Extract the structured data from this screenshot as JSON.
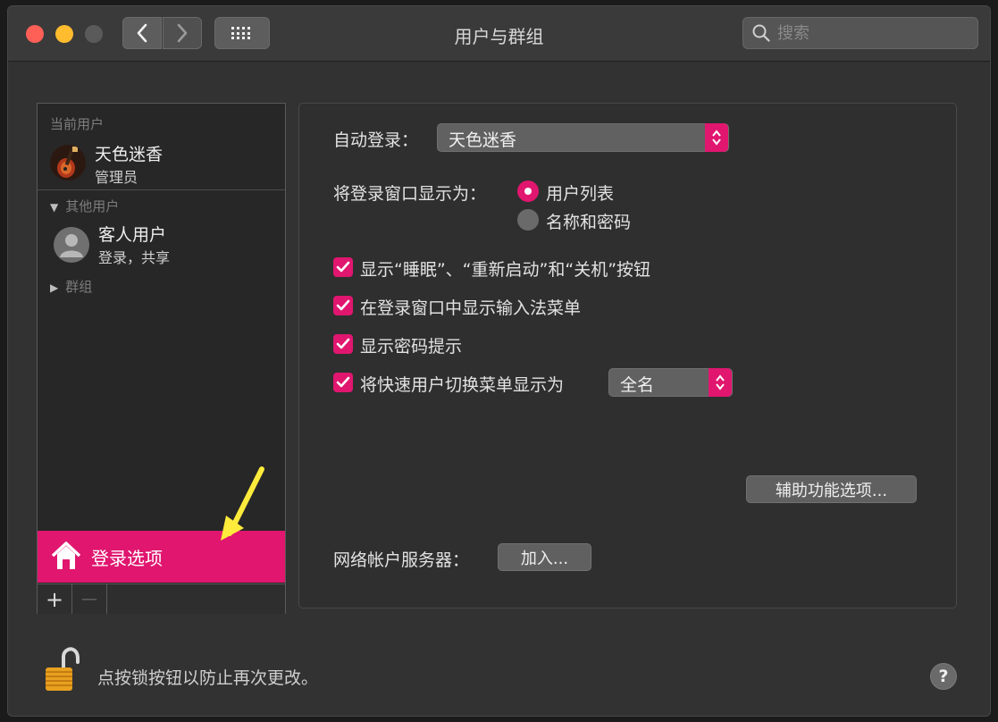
{
  "window": {
    "title": "用户与群组"
  },
  "search": {
    "placeholder": "搜索"
  },
  "sidebar": {
    "current_users_label": "当前用户",
    "current_user": {
      "name": "天色迷香",
      "role": "管理员"
    },
    "other_users_label": "其他用户",
    "guest_user": {
      "name": "客人用户",
      "role": "登录，共享"
    },
    "groups_label": "群组",
    "login_options_label": "登录选项",
    "add_symbol": "+",
    "remove_symbol": "—"
  },
  "main": {
    "auto_login_label": "自动登录：",
    "auto_login_value": "天色迷香",
    "display_login_label": "将登录窗口显示为：",
    "radio_user_list": "用户列表",
    "radio_name_password": "名称和密码",
    "cb_show_buttons": "显示“睡眠”、“重新启动”和“关机”按钮",
    "cb_input_menu": "在登录窗口中显示输入法菜单",
    "cb_password_hint": "显示密码提示",
    "cb_fast_user": "将快速用户切换菜单显示为",
    "fast_user_value": "全名",
    "accessibility_button": "辅助功能选项...",
    "network_server_label": "网络帐户服务器：",
    "join_button": "加入..."
  },
  "footer": {
    "lock_text": "点按锁按钮以防止再次更改。",
    "help_symbol": "?"
  },
  "colors": {
    "accent": "#e0166f",
    "annotation_arrow": "#ffeb3b"
  }
}
